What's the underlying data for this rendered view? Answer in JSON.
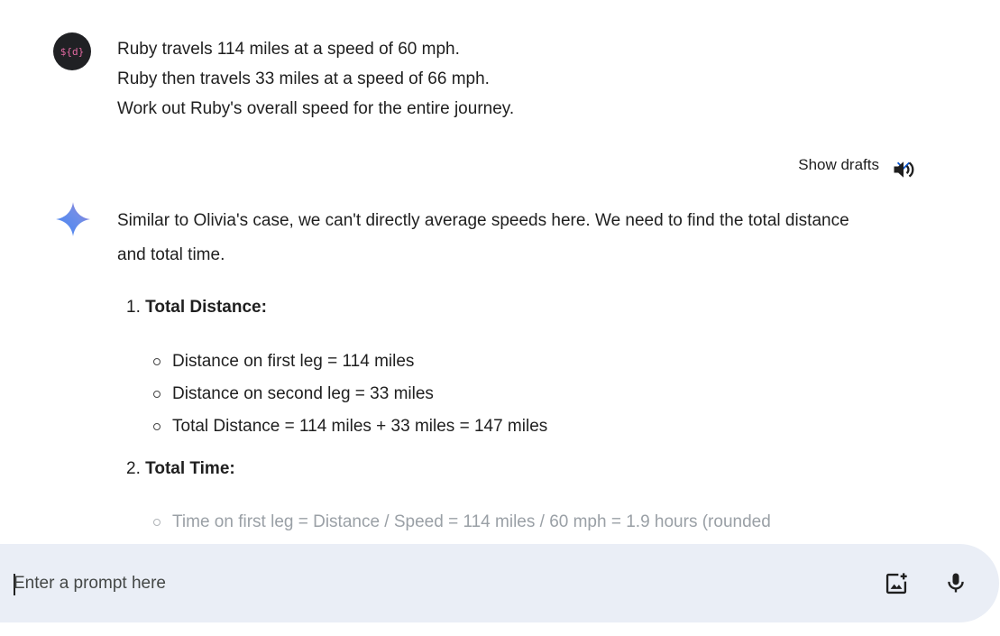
{
  "user": {
    "avatar_text": "${d}",
    "lines": [
      "Ruby travels 114 miles at a speed of 60 mph.",
      "Ruby then travels 33 miles at a speed of 66 mph.",
      "Work out Ruby's overall speed for the entire journey."
    ]
  },
  "drafts": {
    "label": "Show drafts",
    "icon": "chevron-down-icon",
    "accent": "#0b57d0"
  },
  "read_aloud_icon": "speaker-icon",
  "response": {
    "intro": "Similar to Olivia's case, we can't directly average speeds here. We need to find the total distance and total time.",
    "steps": [
      {
        "number": "1.",
        "title": "Total Distance:",
        "bullets": [
          "Distance on first leg = 114 miles",
          "Distance on second leg = 33 miles",
          "Total Distance = 114 miles + 33 miles = 147 miles"
        ]
      },
      {
        "number": "2.",
        "title": "Total Time:",
        "bullets": [
          "Time on first leg = Distance / Speed = 114 miles / 60 mph = 1.9 hours (rounded"
        ]
      }
    ]
  },
  "prompt": {
    "placeholder": "Enter a prompt here",
    "value": ""
  },
  "colors": {
    "prompt_bg": "#eaeef6",
    "spark_blue": "#4285f4",
    "spark_purple": "#9b72cb"
  }
}
